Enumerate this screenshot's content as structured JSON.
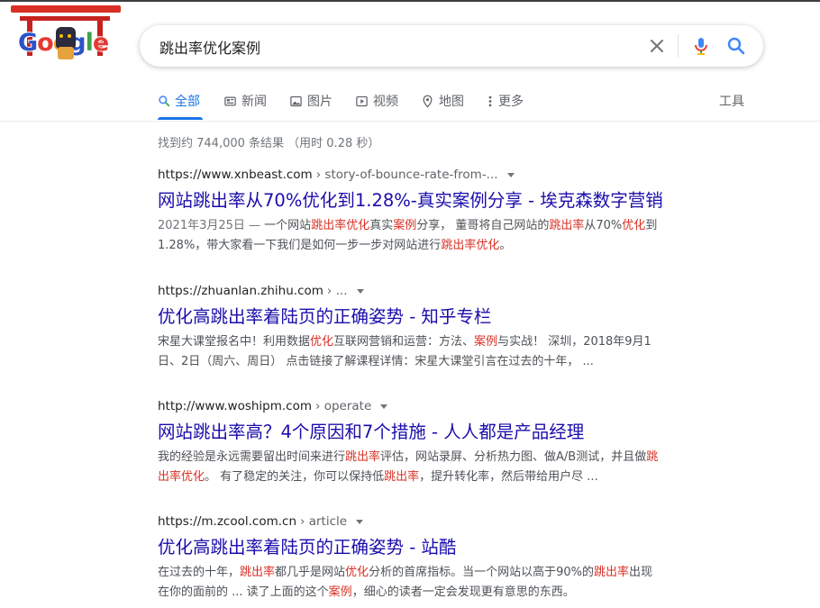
{
  "logo": {
    "letters": [
      "G",
      "o",
      "o",
      "g",
      "l",
      "e"
    ]
  },
  "search": {
    "query": "跳出率优化案例"
  },
  "tabs": [
    {
      "label": "全部",
      "icon": "search-icon",
      "active": true
    },
    {
      "label": "新闻",
      "icon": "news-icon",
      "active": false
    },
    {
      "label": "图片",
      "icon": "image-icon",
      "active": false
    },
    {
      "label": "视频",
      "icon": "video-icon",
      "active": false
    },
    {
      "label": "地图",
      "icon": "map-pin-icon",
      "active": false
    },
    {
      "label": "更多",
      "icon": "more-icon",
      "active": false
    }
  ],
  "tools_label": "工具",
  "stats": "找到约 744,000 条结果 （用时 0.28 秒）",
  "results": [
    {
      "url": "https://www.xnbeast.com",
      "path": "› story-of-bounce-rate-from-...",
      "title": "网站跳出率从70%优化到1.28%-真实案例分享 - 埃克森数字营销",
      "snippet_lines": [
        [
          {
            "t": "2021年3月25日 — ",
            "date": true
          },
          {
            "t": "一个网站"
          },
          {
            "t": "跳出率优化",
            "hl": true
          },
          {
            "t": "真实"
          },
          {
            "t": "案例",
            "hl": true
          },
          {
            "t": "分享， 董哥将自己网站的"
          },
          {
            "t": "跳出率",
            "hl": true
          },
          {
            "t": "从70%"
          },
          {
            "t": "优化",
            "hl": true
          },
          {
            "t": "到"
          }
        ],
        [
          {
            "t": "1.28%，带大家看一下我们是如何一步一步对网站进行"
          },
          {
            "t": "跳出率优化",
            "hl": true
          },
          {
            "t": "。"
          }
        ]
      ]
    },
    {
      "url": "https://zhuanlan.zhihu.com",
      "path": "› ...",
      "title": "优化高跳出率着陆页的正确姿势 - 知乎专栏",
      "snippet_lines": [
        [
          {
            "t": "宋星大课堂报名中！利用数据"
          },
          {
            "t": "优化",
            "hl": true
          },
          {
            "t": "互联网营销和运营：方法、"
          },
          {
            "t": "案例",
            "hl": true
          },
          {
            "t": "与实战！ 深圳，2018年9月1"
          }
        ],
        [
          {
            "t": "日、2日（周六、周日） 点击链接了解课程详情：宋星大课堂引言在过去的十年， ..."
          }
        ]
      ]
    },
    {
      "url": "http://www.woshipm.com",
      "path": "› operate",
      "title": "网站跳出率高？4个原因和7个措施 - 人人都是产品经理",
      "snippet_lines": [
        [
          {
            "t": "我的经验是永远需要留出时间来进行"
          },
          {
            "t": "跳出率",
            "hl": true
          },
          {
            "t": "评估，网站录屏、分析热力图、做A/B测试，并且做"
          },
          {
            "t": "跳",
            "hl": true
          }
        ],
        [
          {
            "t": "出率优化",
            "hl": true
          },
          {
            "t": "。 有了稳定的关注，你可以保持低"
          },
          {
            "t": "跳出率",
            "hl": true
          },
          {
            "t": "，提升转化率，然后带给用户尽 ..."
          }
        ]
      ]
    },
    {
      "url": "https://m.zcool.com.cn",
      "path": "› article",
      "title": "优化高跳出率着陆页的正确姿势 - 站酷",
      "snippet_lines": [
        [
          {
            "t": "在过去的十年，"
          },
          {
            "t": "跳出率",
            "hl": true
          },
          {
            "t": "都几乎是网站"
          },
          {
            "t": "优化",
            "hl": true
          },
          {
            "t": "分析的首席指标。当一个网站以高于90%的"
          },
          {
            "t": "跳出率",
            "hl": true
          },
          {
            "t": "出现"
          }
        ],
        [
          {
            "t": "在你的面前的 ... 读了上面的这个"
          },
          {
            "t": "案例",
            "hl": true
          },
          {
            "t": "，细心的读者一定会发现更有意思的东西。"
          }
        ]
      ]
    }
  ],
  "colors": {
    "link_title": "#1a0dab",
    "highlight": "#d93025",
    "accent": "#1a73e8",
    "snippet": "#4d5156"
  }
}
